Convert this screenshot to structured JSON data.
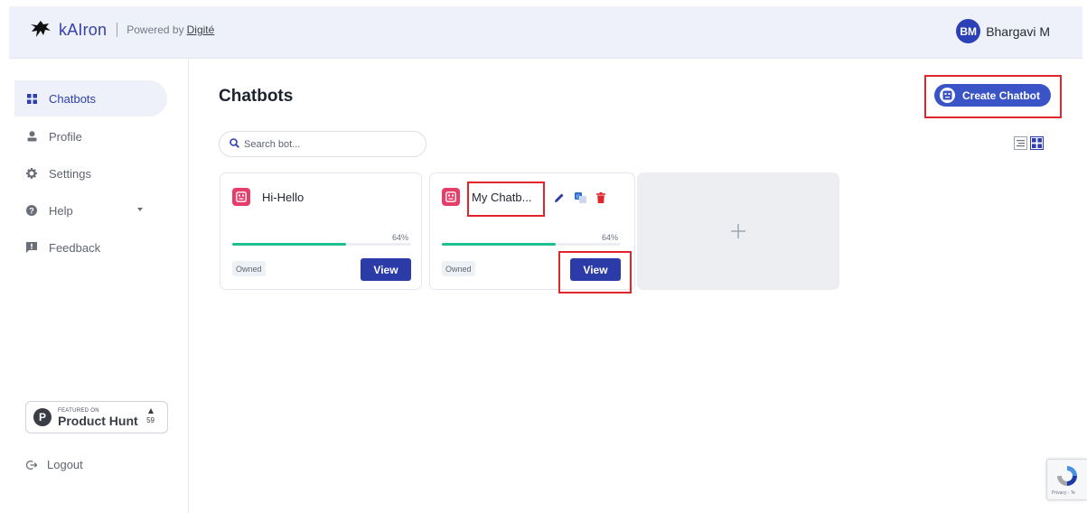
{
  "header": {
    "app_name": "kAIron",
    "powered_by": "Powered by",
    "powered_by_link": "Digité",
    "user_initials": "BM",
    "user_name": "Bhargavi M"
  },
  "sidebar": {
    "items": [
      {
        "label": "Chatbots",
        "icon": "grid-icon",
        "active": true
      },
      {
        "label": "Profile",
        "icon": "person-icon"
      },
      {
        "label": "Settings",
        "icon": "gear-icon"
      },
      {
        "label": "Help",
        "icon": "help-icon"
      },
      {
        "label": "Feedback",
        "icon": "feedback-icon"
      }
    ],
    "product_hunt": {
      "featured_on": "FEATURED ON",
      "name": "Product Hunt",
      "votes": "59"
    },
    "logout_label": "Logout"
  },
  "main": {
    "title": "Chatbots",
    "create_button_label": "Create Chatbot",
    "search_placeholder": "Search bot...",
    "cards": [
      {
        "name": "Hi-Hello",
        "progress_label": "64%",
        "progress": 0.64,
        "badge": "Owned",
        "view_label": "View"
      },
      {
        "name": "My Chatb...",
        "progress_label": "64%",
        "progress": 0.64,
        "badge": "Owned",
        "view_label": "View"
      }
    ],
    "add_card_symbol": "+"
  },
  "recaptcha": {
    "text": "Privacy - Te"
  },
  "colors": {
    "primary": "#2b3ca8",
    "accent_blue": "#3a54c8",
    "progress": "#1fbf8f",
    "bot_icon": "#e53e6b",
    "highlight": "#e0262b",
    "header_bg": "#eef1fa"
  }
}
